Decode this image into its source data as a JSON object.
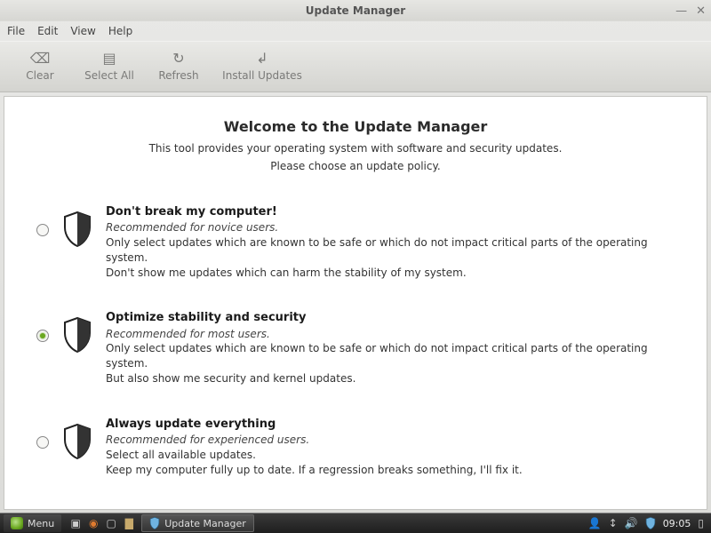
{
  "window": {
    "title": "Update Manager"
  },
  "menubar": {
    "file": "File",
    "edit": "Edit",
    "view": "View",
    "help": "Help"
  },
  "toolbar": {
    "clear": "Clear",
    "select_all": "Select All",
    "refresh": "Refresh",
    "install": "Install Updates"
  },
  "content": {
    "heading": "Welcome to the Update Manager",
    "sub1": "This tool provides your operating system with software and security updates.",
    "sub2": "Please choose an update policy."
  },
  "policies": [
    {
      "title": "Don't break my computer!",
      "rec": "Recommended for novice users.",
      "desc1": "Only select updates which are known to be safe or which do not impact critical parts of the operating system.",
      "desc2": "Don't show me updates which can harm the stability of my system.",
      "selected": false
    },
    {
      "title": "Optimize stability and security",
      "rec": "Recommended for most users.",
      "desc1": "Only select updates which are known to be safe or which do not impact critical parts of the operating system.",
      "desc2": "But also show me security and kernel updates.",
      "selected": true
    },
    {
      "title": "Always update everything",
      "rec": "Recommended for experienced users.",
      "desc1": "Select all available updates.",
      "desc2": "Keep my computer fully up to date. If a regression breaks something, I'll fix it.",
      "selected": false
    }
  ],
  "taskbar": {
    "menu": "Menu",
    "app": "Update Manager",
    "clock": "09:05"
  }
}
